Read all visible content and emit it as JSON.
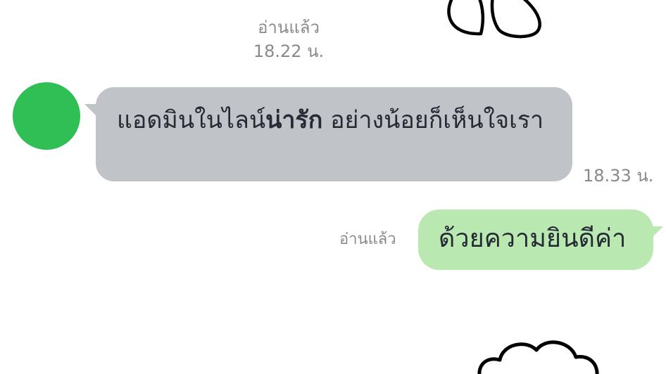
{
  "chat": {
    "top_meta": {
      "read_label": "อ่านแล้ว",
      "time": "18.22 น."
    },
    "incoming": {
      "text_before": "แอดมินในไลน์",
      "text_bold": "น่ารัก",
      "text_after": " อย่างน้อยก็เห็นใจเรา",
      "time": "18.33 น."
    },
    "outgoing": {
      "read_label": "อ่านแล้ว",
      "text": "ด้วยความยินดีค่า"
    },
    "icons": {
      "avatar": "avatar-green-circle",
      "sticker_top": "bunny-ears-sticker-icon",
      "sticker_bottom": "cloud-sticker-icon"
    },
    "colors": {
      "incoming_bubble": "#c0c3c8",
      "outgoing_bubble": "#b9e8b1",
      "avatar": "#2fbf55",
      "meta_text": "#8a8a8a"
    }
  }
}
